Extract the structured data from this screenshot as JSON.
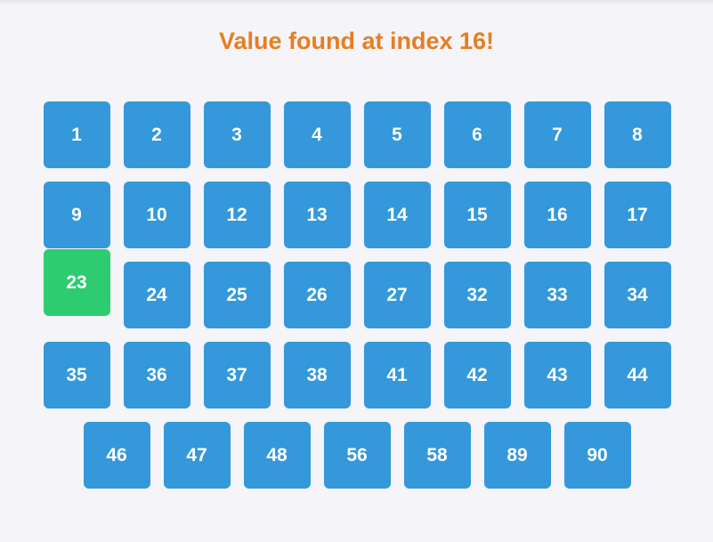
{
  "status": {
    "message": "Value found at index 16!",
    "color": "#e67e22"
  },
  "colors": {
    "default_cell": "#3498db",
    "found_cell": "#2ecc71"
  },
  "found_index": 16,
  "array": [
    1,
    2,
    3,
    4,
    5,
    6,
    7,
    8,
    9,
    10,
    12,
    13,
    14,
    15,
    16,
    17,
    23,
    24,
    25,
    26,
    27,
    32,
    33,
    34,
    35,
    36,
    37,
    38,
    41,
    42,
    43,
    44,
    46,
    47,
    48,
    56,
    58,
    89,
    90
  ]
}
